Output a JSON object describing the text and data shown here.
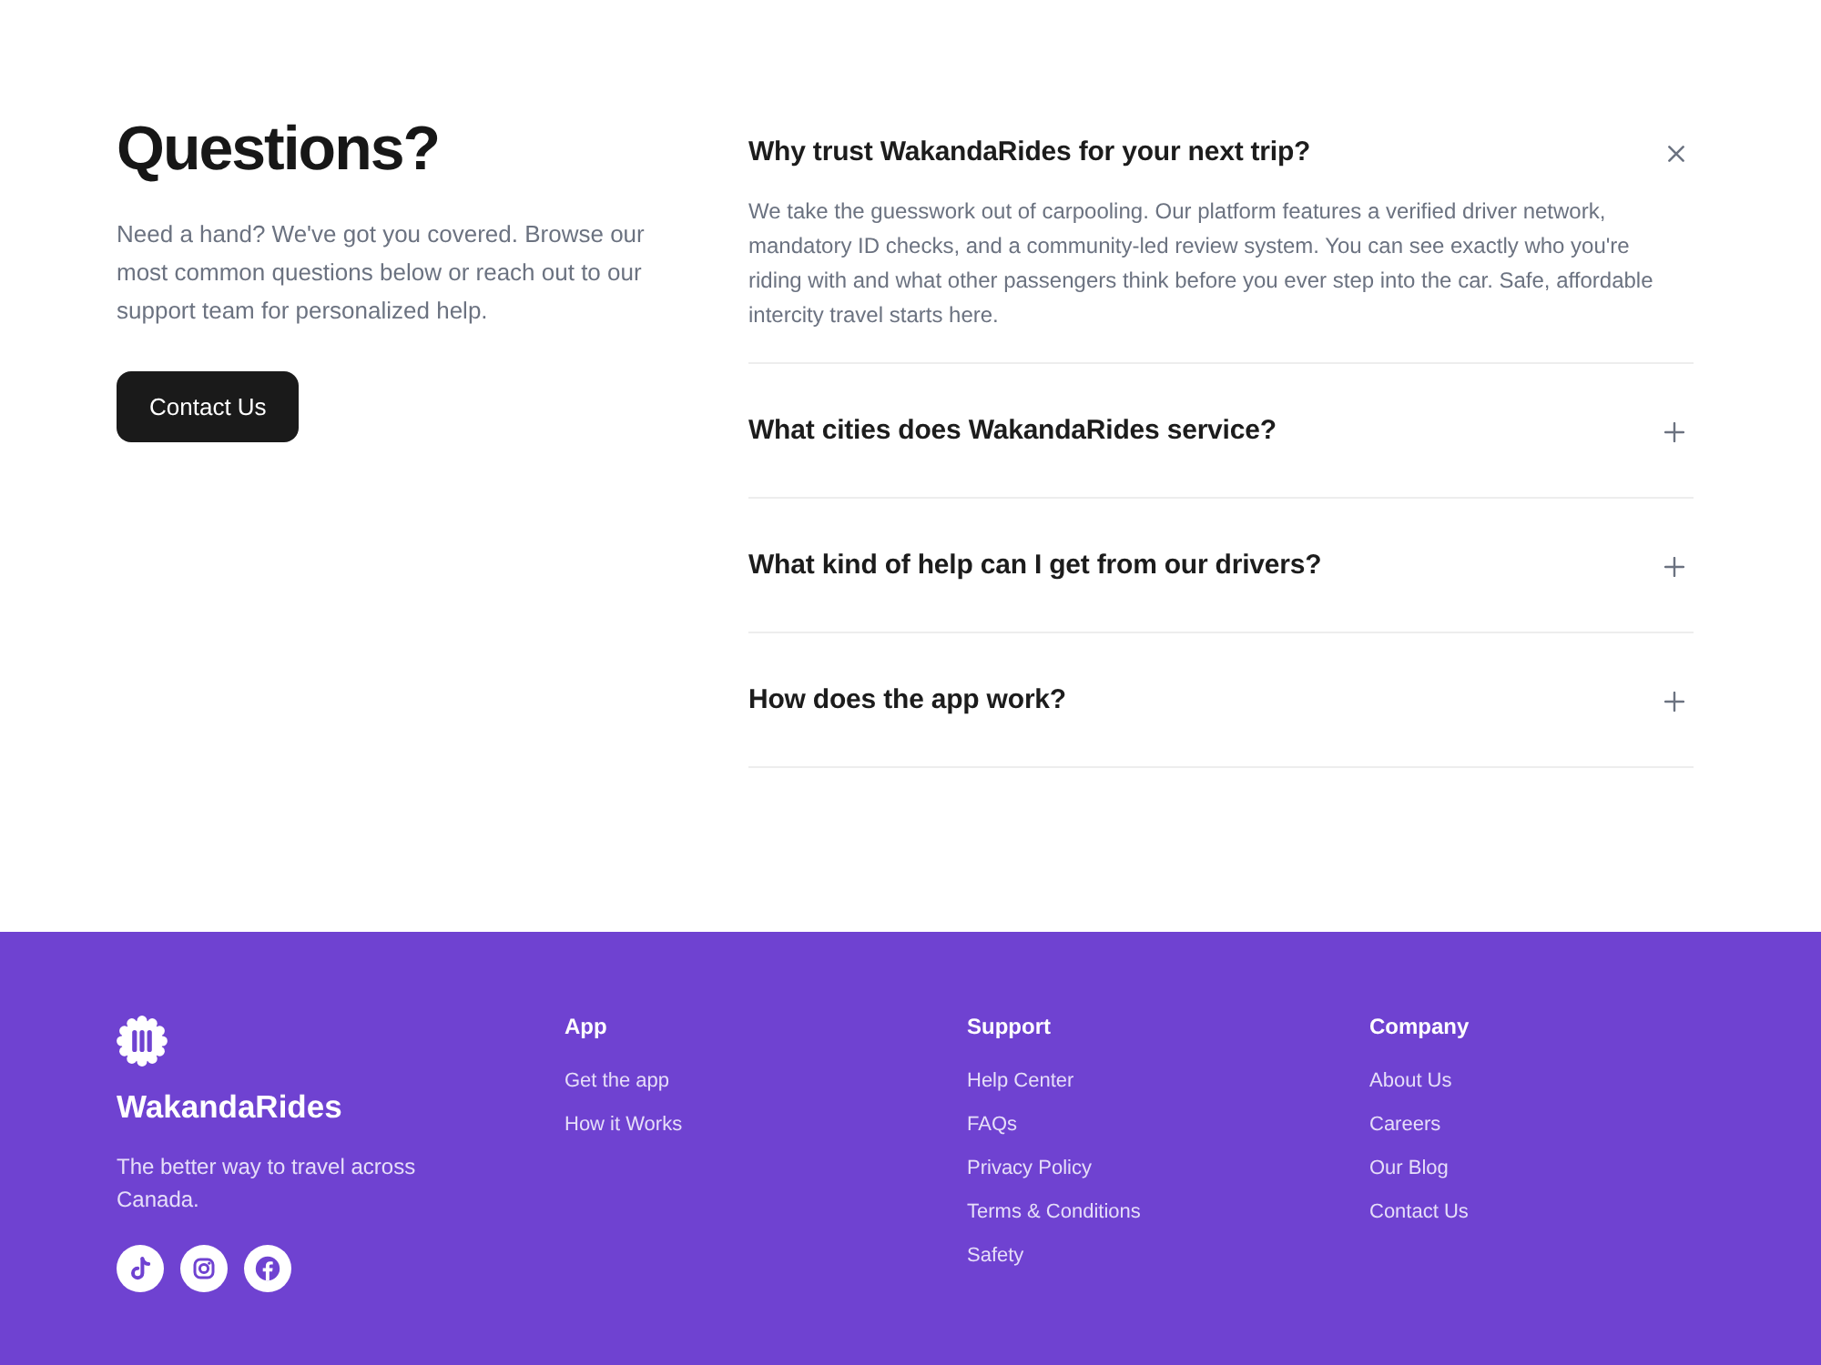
{
  "faq": {
    "title": "Questions?",
    "intro": "Need a hand? We've got you covered. Browse our most common questions below or reach out to our support team for personalized help.",
    "contact_button": "Contact Us",
    "items": [
      {
        "question": "Why trust WakandaRides for your next trip?",
        "answer": "We take the guesswork out of carpooling. Our platform features a verified driver network, mandatory ID checks, and a community-led review system. You can see exactly who you're riding with and what other passengers think before you ever step into the car. Safe, affordable intercity travel starts here.",
        "expanded": true
      },
      {
        "question": "What cities does WakandaRides service?",
        "expanded": false
      },
      {
        "question": "What kind of help can I get from our drivers?",
        "expanded": false
      },
      {
        "question": "How does the app work?",
        "expanded": false
      }
    ]
  },
  "footer": {
    "brand": "WakandaRides",
    "tagline": "The better way to travel across Canada.",
    "social": [
      {
        "kind": "tiktok"
      },
      {
        "kind": "instagram"
      },
      {
        "kind": "facebook"
      }
    ],
    "columns": [
      {
        "heading": "App",
        "links": [
          "Get the app",
          "How it Works"
        ]
      },
      {
        "heading": "Support",
        "links": [
          "Help Center",
          "FAQs",
          "Privacy Policy",
          "Terms & Conditions",
          "Safety"
        ]
      },
      {
        "heading": "Company",
        "links": [
          "About Us",
          "Careers",
          "Our Blog",
          "Contact Us"
        ]
      }
    ]
  }
}
